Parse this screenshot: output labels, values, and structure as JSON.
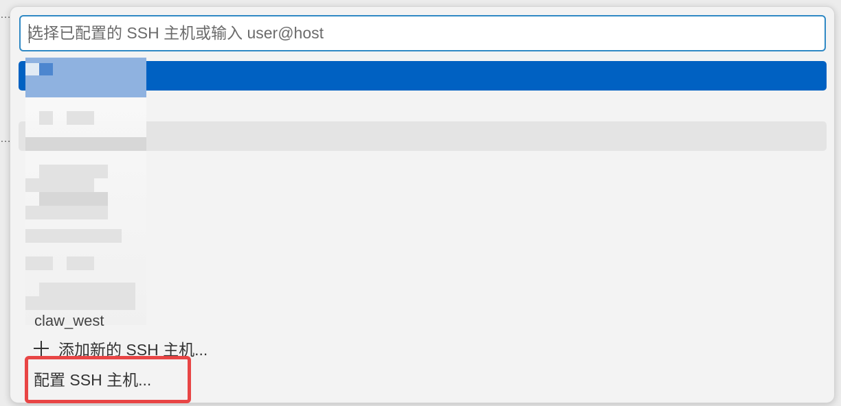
{
  "background": {
    "ellipsis_top": "…",
    "ellipsis_mid": "…"
  },
  "quick_pick": {
    "search": {
      "placeholder": "选择已配置的 SSH 主机或输入 user@host",
      "value": ""
    },
    "hosts": [
      {
        "label": "claw_west"
      }
    ],
    "actions": {
      "add_new_host": "添加新的 SSH 主机...",
      "configure_hosts": "配置 SSH 主机..."
    },
    "colors": {
      "selected_row": "#0061c2",
      "focus_border": "#2e88c4",
      "annotation": "#e84545"
    }
  }
}
